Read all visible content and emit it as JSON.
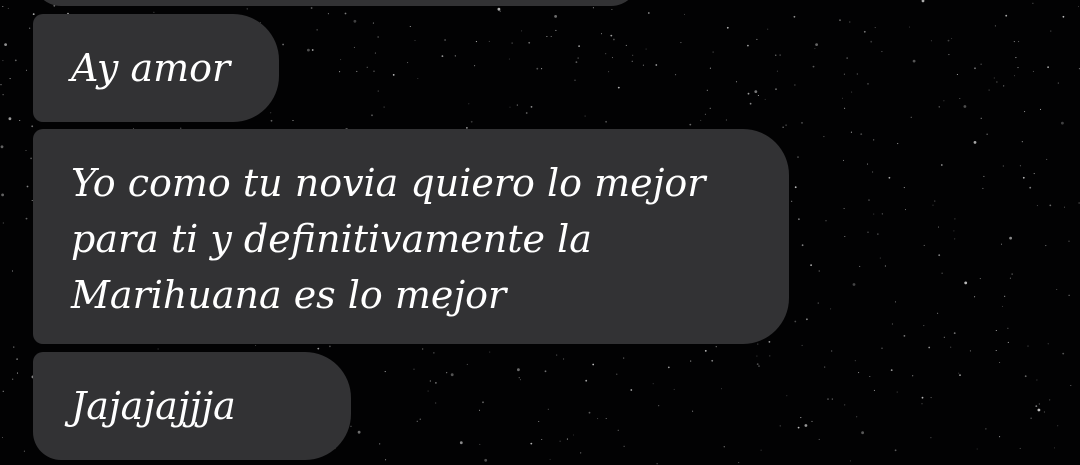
{
  "messages": [
    {
      "text": ""
    },
    {
      "text": "Ay amor"
    },
    {
      "lines": [
        "Yo como tu novia quiero lo mejor",
        "para ti y definitivamente la",
        "Marihuana es lo mejor"
      ]
    },
    {
      "text": "Jajajajjja"
    }
  ],
  "colors": {
    "background": "#020203",
    "bubble": "#323234",
    "text": "#ffffff",
    "stars": "#d9d9d9"
  }
}
